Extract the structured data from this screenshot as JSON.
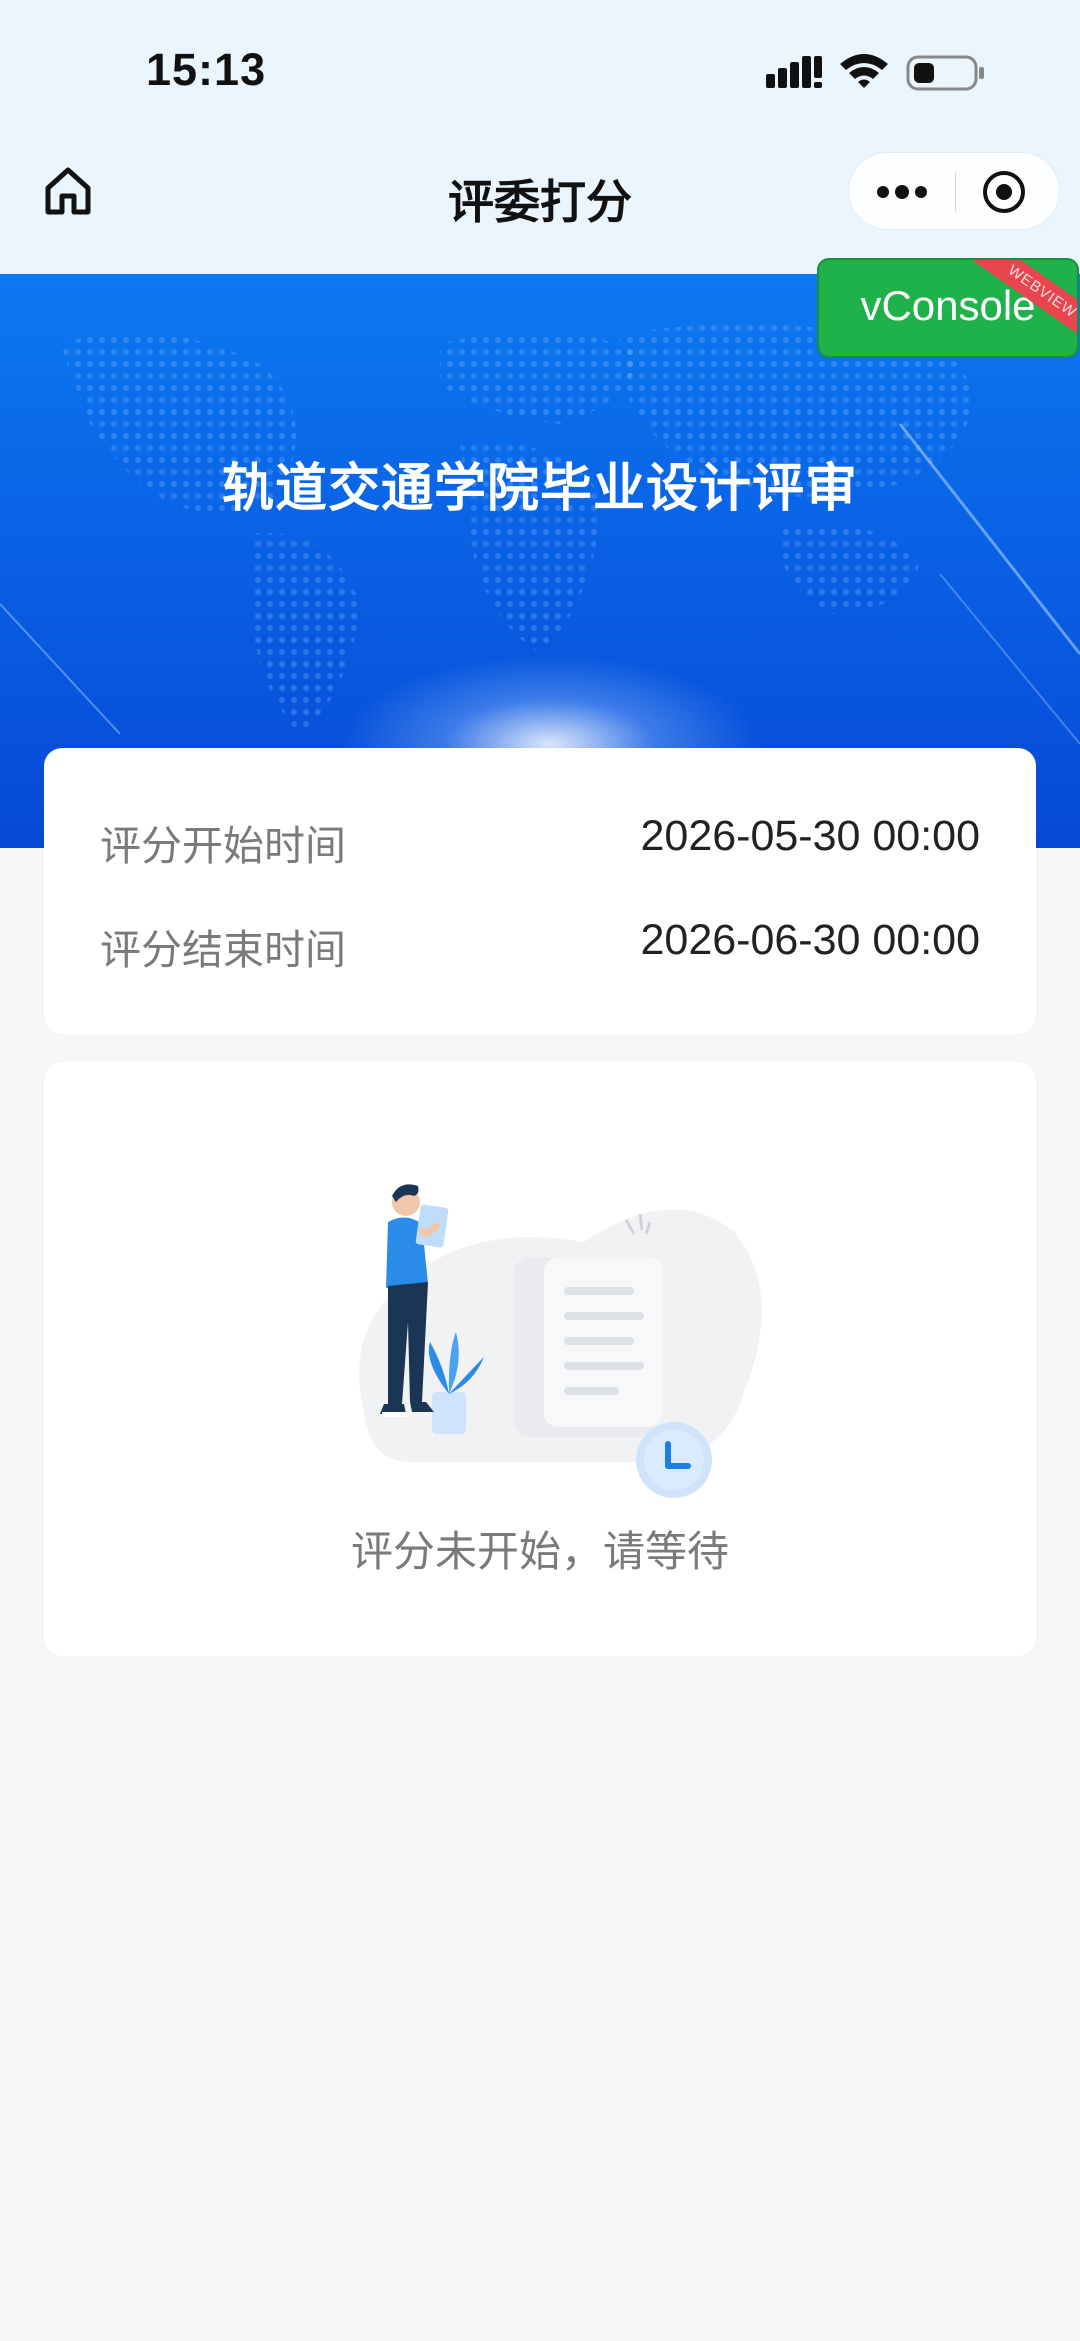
{
  "status_bar": {
    "time": "15:13",
    "icons": [
      "signal-icon",
      "wifi-icon",
      "battery-icon"
    ]
  },
  "nav": {
    "title": "评委打分",
    "home_icon": "home-icon",
    "more_icon": "more-dots-icon",
    "close_icon": "target-close-icon"
  },
  "vconsole": {
    "label": "vConsole",
    "ribbon": "WEBVIEW"
  },
  "banner": {
    "title": "轨道交通学院毕业设计评审"
  },
  "schedule": {
    "rows": [
      {
        "label": "评分开始时间",
        "value": "2026-05-30 00:00"
      },
      {
        "label": "评分结束时间",
        "value": "2026-06-30 00:00"
      }
    ]
  },
  "status": {
    "message": "评分未开始，请等待",
    "illustration": "waiting-illustration"
  },
  "colors": {
    "banner_top": "#0b79f0",
    "banner_bottom": "#0648d6",
    "vconsole_green": "#1fb14a",
    "ribbon_red": "#e9454f",
    "page_bg": "#f6f6f6",
    "chrome_bg": "#eaf5fd"
  }
}
